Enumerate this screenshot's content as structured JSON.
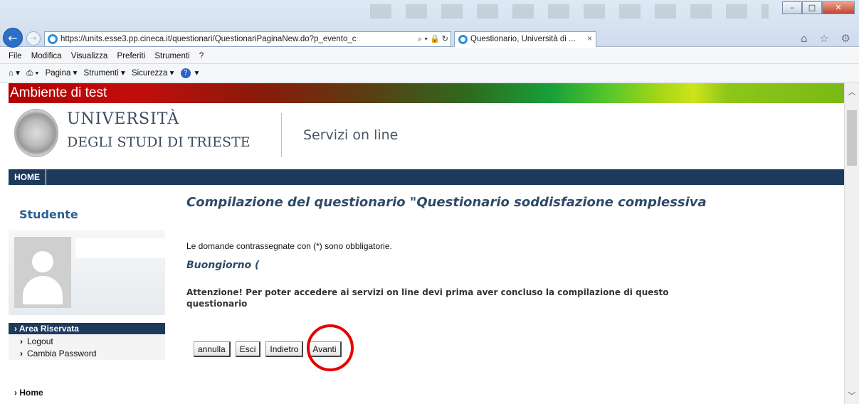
{
  "browser": {
    "address": "https://units.esse3.pp.cineca.it/questionari/QuestionariPaginaNew.do?p_evento_c",
    "address_tools": "⌕ ▾ 🔒 ↻",
    "tab_title": "Questionario, Università di ...",
    "tab_close": "×",
    "right_icons": "⌂ ☆ ⚙",
    "window_buttons": {
      "minimize": "–",
      "maximize": "□",
      "close": "✕"
    },
    "back_icon": "←",
    "forward_icon": "→"
  },
  "menubar": [
    "File",
    "Modifica",
    "Visualizza",
    "Preferiti",
    "Strumenti",
    "?"
  ],
  "commandbar": {
    "home": "⌂ ▾",
    "print": "⎙ ▾",
    "items": [
      "Pagina ▾",
      "Strumenti ▾",
      "Sicurezza ▾"
    ],
    "help": "?",
    "help_arrow": "▾"
  },
  "page": {
    "test_banner": "Ambiente di test",
    "university_line1": "UNIVERSITÀ",
    "university_line2": "DEGLI STUDI DI TRIESTE",
    "services": "Servizi on line",
    "nav_home": "HOME",
    "sidebar": {
      "title": "Studente",
      "area": "Area Riservata",
      "links": [
        "Logout",
        "Cambia Password"
      ],
      "home": "Home"
    },
    "main": {
      "title": "Compilazione del questionario \"Questionario soddisfazione complessiva",
      "required_note": "Le domande contrassegnate con (*) sono obbligatorie.",
      "greeting": "Buongiorno (",
      "warning": "Attenzione! Per poter accedere ai servizi on line devi prima aver concluso la compilazione di questo questionario",
      "buttons": [
        "annulla",
        "Esci",
        "Indietro",
        "Avanti"
      ]
    }
  },
  "scrollbar": {
    "up": "︿",
    "down": "﹀"
  }
}
